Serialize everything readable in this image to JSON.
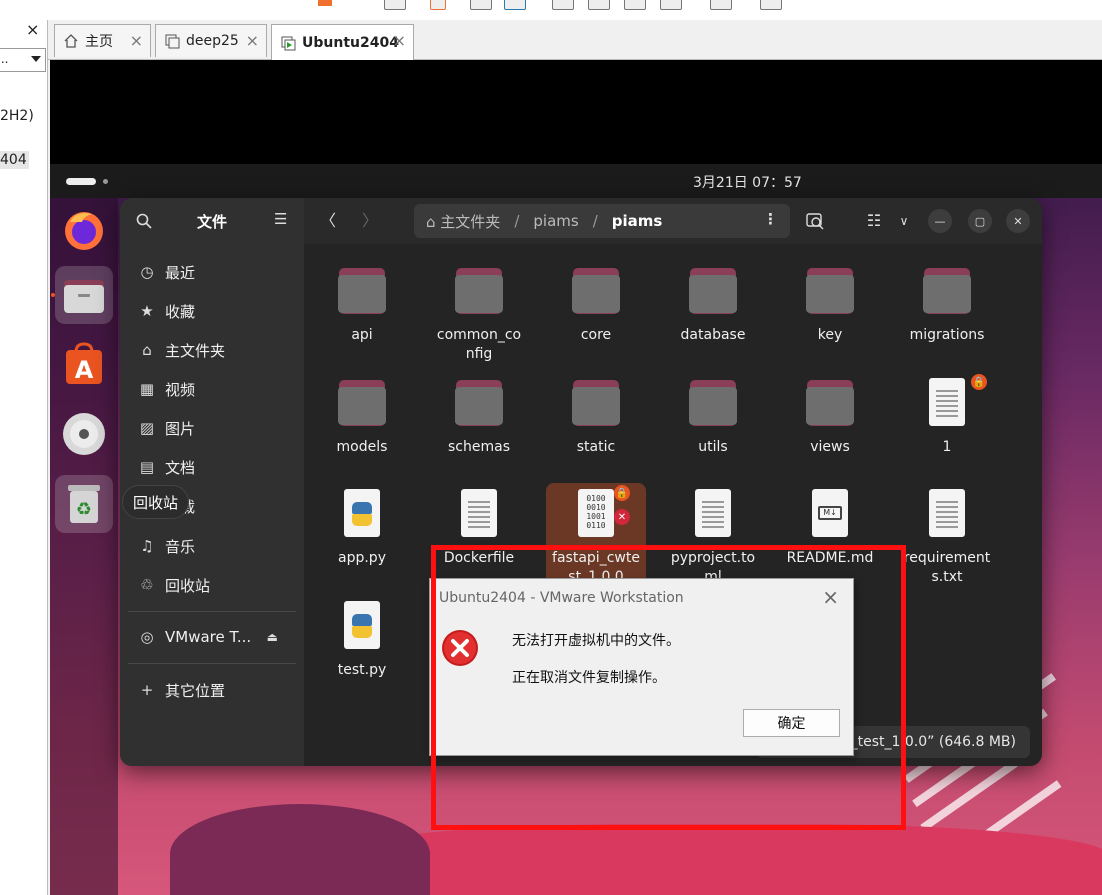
{
  "host": {
    "sidebar": {
      "close_glyph": "×",
      "combo_value": "...",
      "lib_item_1": "2H2)",
      "lib_item_2": "404"
    },
    "tabs": [
      {
        "label": "主页",
        "icon": "home-icon"
      },
      {
        "label": "deep25",
        "icon": "vm-icon"
      },
      {
        "label": "Ubuntu2404",
        "icon": "vm-running-icon"
      }
    ],
    "tab_close_glyph": "×"
  },
  "vm": {
    "clock": "3月21日  07：57",
    "dock_tooltip": "回收站",
    "dock_items": [
      {
        "name": "firefox-icon"
      },
      {
        "name": "files-icon"
      },
      {
        "name": "app-center-icon"
      },
      {
        "name": "disc-icon"
      },
      {
        "name": "trash-icon"
      }
    ],
    "files": {
      "sidebar_title": "文件",
      "sidebar_items": [
        {
          "label": "最近",
          "icon": "clock-icon",
          "glyph": "◷"
        },
        {
          "label": "收藏",
          "icon": "star-icon",
          "glyph": "★"
        },
        {
          "label": "主文件夹",
          "icon": "home-icon",
          "glyph": "⌂"
        },
        {
          "label": "视频",
          "icon": "video-icon",
          "glyph": "▦"
        },
        {
          "label": "图片",
          "icon": "image-icon",
          "glyph": "▨"
        },
        {
          "label": "文档",
          "icon": "document-icon",
          "glyph": "▤"
        },
        {
          "label": "下载",
          "icon": "download-icon",
          "glyph": "⤓"
        },
        {
          "label": "音乐",
          "icon": "music-icon",
          "glyph": "♫"
        },
        {
          "label": "回收站",
          "icon": "trash-icon",
          "glyph": "♲"
        }
      ],
      "mount_item": {
        "label": "VMware T...",
        "eject": "⏏"
      },
      "other_locations": {
        "label": "其它位置",
        "glyph": "+"
      },
      "path": {
        "home_label": "主文件夹",
        "seg1": "piams",
        "current": "piams",
        "separator": "/"
      },
      "items": [
        {
          "name": "api",
          "type": "folder"
        },
        {
          "name": "common_config",
          "type": "folder"
        },
        {
          "name": "core",
          "type": "folder"
        },
        {
          "name": "database",
          "type": "folder"
        },
        {
          "name": "key",
          "type": "folder"
        },
        {
          "name": "migrations",
          "type": "folder"
        },
        {
          "name": "models",
          "type": "folder"
        },
        {
          "name": "schemas",
          "type": "folder"
        },
        {
          "name": "static",
          "type": "folder"
        },
        {
          "name": "utils",
          "type": "folder"
        },
        {
          "name": "views",
          "type": "folder"
        },
        {
          "name": "1",
          "type": "text",
          "locked": true
        },
        {
          "name": "app.py",
          "type": "python"
        },
        {
          "name": "Dockerfile",
          "type": "text"
        },
        {
          "name": "fastapi_cwtest_1.0.0",
          "type": "binary",
          "locked": true,
          "error": true,
          "selected": true,
          "binary_text": "0100\n0010\n1001\n0110"
        },
        {
          "name": "pyproject.toml",
          "type": "text"
        },
        {
          "name": "README.md",
          "type": "markdown",
          "md_label": "M↓"
        },
        {
          "name": "requirements.txt",
          "type": "text"
        },
        {
          "name": "test.py",
          "type": "python"
        }
      ],
      "status": "“fastapi_cw_test_1.0.0” (646.8 MB)"
    }
  },
  "dialog": {
    "title": "Ubuntu2404 - VMware Workstation",
    "close_glyph": "×",
    "message_1": "无法打开虚拟机中的文件。",
    "message_2": "正在取消文件复制操作。",
    "ok_label": "确定"
  },
  "colors": {
    "highlight_box": "#ff1010",
    "selection": "#6b3825",
    "folder_tab": "#8a3e58",
    "accent": "#e95420"
  }
}
